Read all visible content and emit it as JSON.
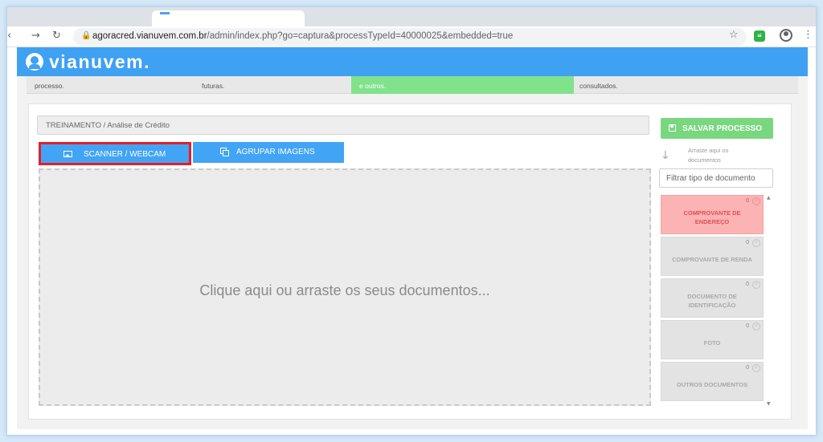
{
  "browser": {
    "url_host": "agoracred.vianuvem.com.br",
    "url_path": "/admin/index.php?go=captura&processTypeId=40000025&embedded=true",
    "extension_badge": "ai"
  },
  "header": {
    "logo_text": "vianuvem."
  },
  "steps": [
    {
      "text": "processo."
    },
    {
      "text": "futuras."
    },
    {
      "text": "e outros."
    },
    {
      "text": "consultados."
    }
  ],
  "panel": {
    "breadcrumb": "TREINAMENTO / Análise de Crédito",
    "scanner_button": "SCANNER / WEBCAM",
    "agrupar_button": "AGRUPAR IMAGENS",
    "dropzone_text": "Clique aqui ou arraste os seus documentos..."
  },
  "sidebar": {
    "save_button": "SALVAR PROCESSO",
    "drag_hint": "Arraste aqui os documentos",
    "filter_placeholder": "Filtrar tipo de documento",
    "documents": [
      {
        "name": "COMPROVANTE DE ENDEREÇO",
        "count": "0",
        "required": true
      },
      {
        "name": "COMPROVANTE DE RENDA",
        "count": "0",
        "required": false
      },
      {
        "name": "DOCUMENTO DE IDENTIFICAÇÃO",
        "count": "0",
        "required": false
      },
      {
        "name": "FOTO",
        "count": "0",
        "required": false
      },
      {
        "name": "OUTROS DOCUMENTOS",
        "count": "0",
        "required": false
      }
    ]
  },
  "colors": {
    "brand_blue": "#3fa1f2",
    "button_blue": "#42a4f4",
    "save_green": "#79d77f",
    "highlight_red": "#e51d2a",
    "required_pink": "#fcb3b3"
  }
}
